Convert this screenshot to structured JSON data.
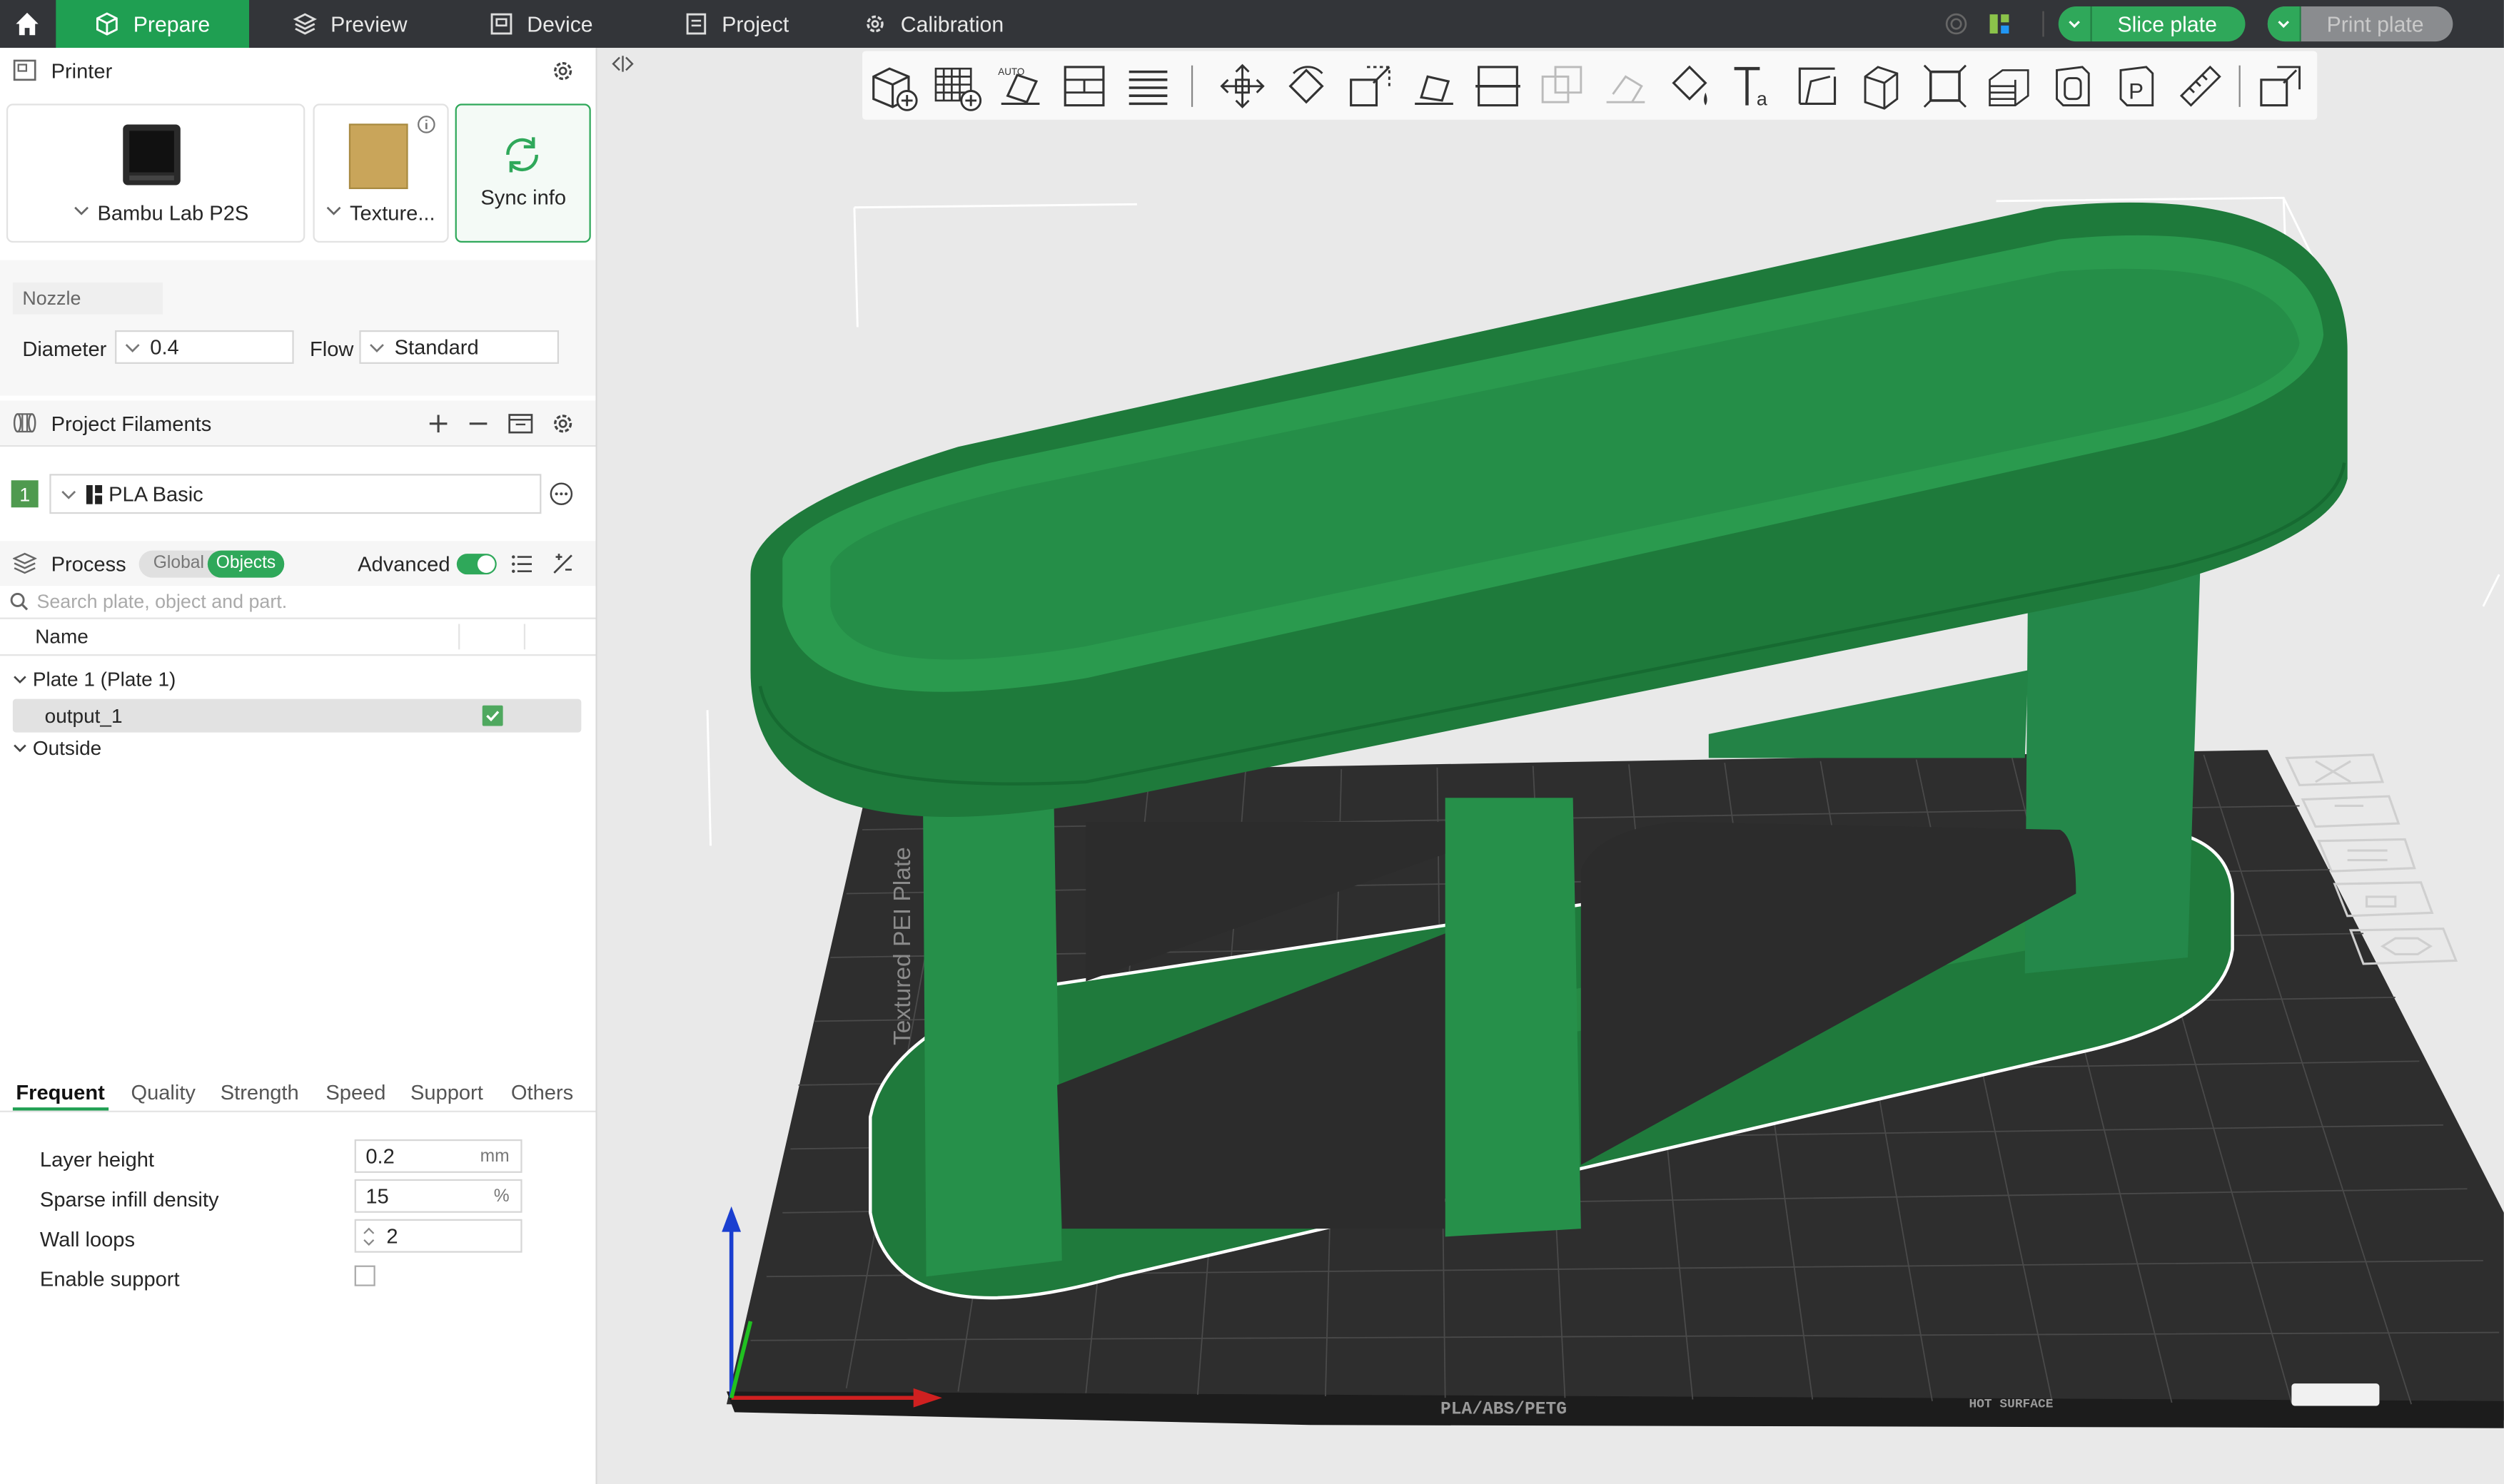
{
  "topbar": {
    "tabs": [
      {
        "label": "Prepare",
        "icon": "cube-outline-icon"
      },
      {
        "label": "Preview",
        "icon": "layers-icon"
      },
      {
        "label": "Device",
        "icon": "device-icon"
      },
      {
        "label": "Project",
        "icon": "project-icon"
      },
      {
        "label": "Calibration",
        "icon": "calibration-gear-icon"
      }
    ],
    "slice_label": "Slice plate",
    "print_label": "Print plate",
    "accent": "#1f9f52"
  },
  "printer": {
    "title": "Printer",
    "printer_name": "Bambu Lab P2S",
    "plate_name": "Texture...",
    "sync_label": "Sync info"
  },
  "nozzle": {
    "title": "Nozzle",
    "diameter_label": "Diameter",
    "diameter_value": "0.4",
    "flow_label": "Flow",
    "flow_value": "Standard"
  },
  "filaments": {
    "title": "Project Filaments",
    "items": [
      {
        "index": "1",
        "name": "PLA Basic",
        "color": "#4f9a4f"
      }
    ]
  },
  "process": {
    "title": "Process",
    "toggle_global": "Global",
    "toggle_objects": "Objects",
    "advanced_label": "Advanced",
    "search_placeholder": "Search plate, object and part.",
    "column_name": "Name",
    "tree": {
      "plate": "Plate 1 (Plate 1)",
      "object": "output_1",
      "outside": "Outside"
    }
  },
  "settings": {
    "tabs": [
      "Frequent",
      "Quality",
      "Strength",
      "Speed",
      "Support",
      "Others"
    ],
    "layer_height": {
      "label": "Layer height",
      "value": "0.2",
      "unit": "mm"
    },
    "infill": {
      "label": "Sparse infill density",
      "value": "15",
      "unit": "%"
    },
    "walls": {
      "label": "Wall loops",
      "value": "2"
    },
    "support": {
      "label": "Enable support",
      "checked": false
    }
  },
  "plate_text": {
    "side": "Textured PEI Plate",
    "front": "PLA/ABS/PETG",
    "hot": "HOT SURFACE"
  }
}
